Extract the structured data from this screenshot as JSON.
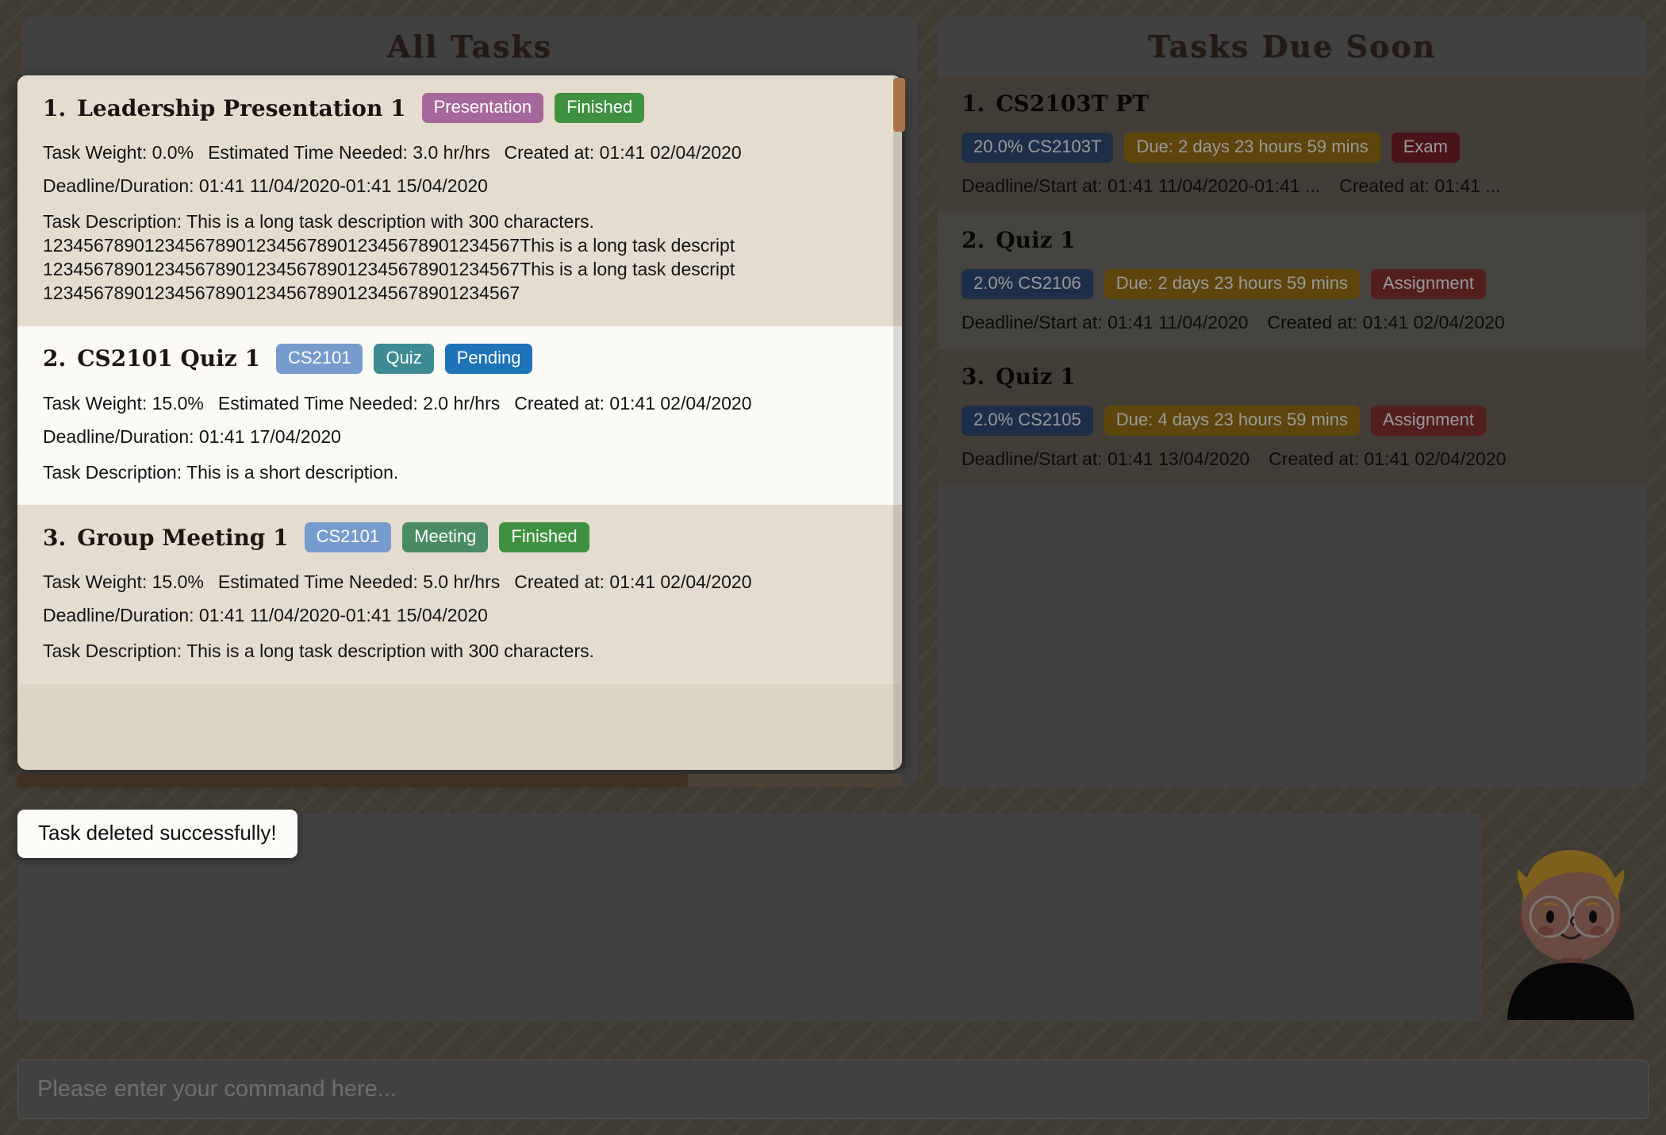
{
  "colors": {
    "page_bg": "#6b6556",
    "panel_bg": "#6d6d6d",
    "title_text": "#3d2b22",
    "card_tan": "#e4ddcf",
    "card_white": "#fcfaf6",
    "scrollbar_thumb": "#a8724b",
    "hscroll_thumb": "#41301f"
  },
  "all_tasks": {
    "title": "All Tasks",
    "tasks": [
      {
        "index": "1.",
        "name": "Leadership Presentation 1",
        "badges": [
          {
            "label": "Presentation",
            "color": "#a6689a"
          },
          {
            "label": "Finished",
            "color": "#3f9142"
          }
        ],
        "weight_label": "Task Weight: 0.0%",
        "time_label": "Estimated Time Needed: 3.0 hr/hrs",
        "created_label": "Created at: 01:41 02/04/2020",
        "deadline_label": "Deadline/Duration: 01:41 11/04/2020-01:41 15/04/2020",
        "description": "Task Description: This is a long task description with 300 characters.\n12345678901234567890123456789012345678901234567This is a long task descript\n12345678901234567890123456789012345678901234567This is a long task descript\n12345678901234567890123456789012345678901234567"
      },
      {
        "index": "2.",
        "name": "CS2101 Quiz 1",
        "badges": [
          {
            "label": "CS2101",
            "color": "#789bce"
          },
          {
            "label": "Quiz",
            "color": "#3d8a93"
          },
          {
            "label": "Pending",
            "color": "#1f73b8"
          }
        ],
        "weight_label": "Task Weight: 15.0%",
        "time_label": "Estimated Time Needed: 2.0 hr/hrs",
        "created_label": "Created at: 01:41 02/04/2020",
        "deadline_label": "Deadline/Duration: 01:41 17/04/2020",
        "description": "Task Description: This is a short description."
      },
      {
        "index": "3.",
        "name": "Group Meeting 1",
        "badges": [
          {
            "label": "CS2101",
            "color": "#789bce"
          },
          {
            "label": "Meeting",
            "color": "#4b8b63"
          },
          {
            "label": "Finished",
            "color": "#3f9142"
          }
        ],
        "weight_label": "Task Weight: 15.0%",
        "time_label": "Estimated Time Needed: 5.0 hr/hrs",
        "created_label": "Created at: 01:41 02/04/2020",
        "deadline_label": "Deadline/Duration: 01:41 11/04/2020-01:41 15/04/2020",
        "description": "Task Description: This is a long task description with 300 characters."
      }
    ]
  },
  "due_soon": {
    "title": "Tasks Due Soon",
    "tasks": [
      {
        "index": "1.",
        "name": "CS2103T PT",
        "badges": [
          {
            "label": "20.0% CS2103T",
            "color": "#2f4d78"
          },
          {
            "label": "Due: 2 days 23 hours 59 mins",
            "color": "#9b7413"
          },
          {
            "label": "Exam",
            "color": "#7c2029"
          }
        ],
        "deadline_label": "Deadline/Start at: 01:41 11/04/2020-01:41 ...",
        "created_label": "Created at: 01:41 ..."
      },
      {
        "index": "2.",
        "name": "Quiz 1",
        "badges": [
          {
            "label": "2.0% CS2106",
            "color": "#2f4d78"
          },
          {
            "label": "Due: 2 days 23 hours 59 mins",
            "color": "#9b7413"
          },
          {
            "label": "Assignment",
            "color": "#8a3230"
          }
        ],
        "deadline_label": "Deadline/Start at: 01:41 11/04/2020",
        "created_label": "Created at: 01:41 02/04/2020"
      },
      {
        "index": "3.",
        "name": "Quiz 1",
        "badges": [
          {
            "label": "2.0% CS2105",
            "color": "#2f4d78"
          },
          {
            "label": "Due: 4 days 23 hours 59 mins",
            "color": "#9b7413"
          },
          {
            "label": "Assignment",
            "color": "#8a3230"
          }
        ],
        "deadline_label": "Deadline/Start at: 01:41 13/04/2020",
        "created_label": "Created at: 01:41 02/04/2020"
      }
    ]
  },
  "toast": {
    "message": "Task deleted successfully!"
  },
  "result_display": {
    "text": ""
  },
  "command_box": {
    "value": "",
    "placeholder": "Please enter your command here..."
  },
  "avatar": {
    "name": "user-avatar-illustration"
  }
}
